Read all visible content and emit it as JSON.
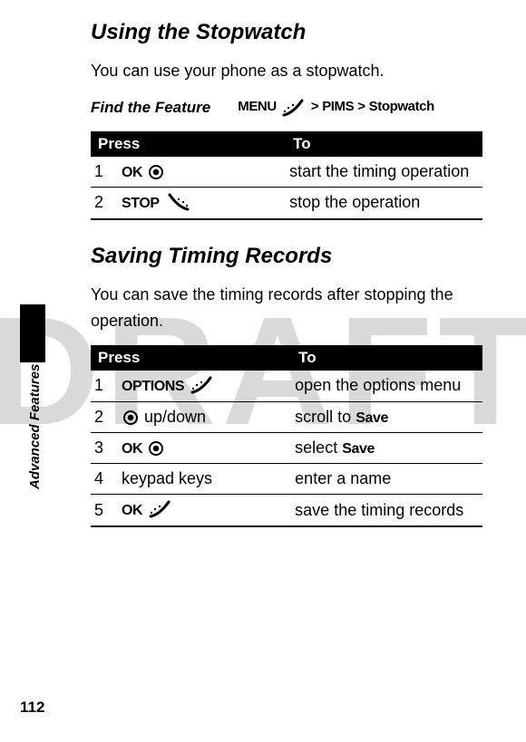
{
  "watermark": "DRAFT",
  "side_label": "Advanced Features",
  "page_number": "112",
  "section1": {
    "title": "Using the Stopwatch",
    "intro": "You can use your phone as a stopwatch.",
    "find_label": "Find the Feature",
    "path": {
      "menu": "MENU",
      "sep": ">",
      "pims": "PIMS",
      "stopwatch": "Stopwatch"
    },
    "table": {
      "head_press": "Press",
      "head_to": "To",
      "rows": [
        {
          "n": "1",
          "press_label": "OK",
          "press_type": "center",
          "to": "start the timing operation"
        },
        {
          "n": "2",
          "press_label": "STOP",
          "press_type": "softkey-left",
          "to": "stop the operation"
        }
      ]
    }
  },
  "section2": {
    "title": "Saving Timing Records",
    "intro": "You can save the timing records after stopping the operation.",
    "table": {
      "head_press": "Press",
      "head_to": "To",
      "rows": [
        {
          "n": "1",
          "press_label": "OPTIONS",
          "press_type": "softkey-right",
          "to": "open the options menu"
        },
        {
          "n": "2",
          "press_label": "up/down",
          "press_type": "center-prefix",
          "to_pre": "scroll to ",
          "to_bold": "Save"
        },
        {
          "n": "3",
          "press_label": "OK",
          "press_type": "center",
          "to_pre": "select ",
          "to_bold": "Save"
        },
        {
          "n": "4",
          "press_label": "keypad keys",
          "press_type": "plain",
          "to": "enter a name"
        },
        {
          "n": "5",
          "press_label": "OK",
          "press_type": "softkey-right",
          "to": "save the timing records"
        }
      ]
    }
  }
}
